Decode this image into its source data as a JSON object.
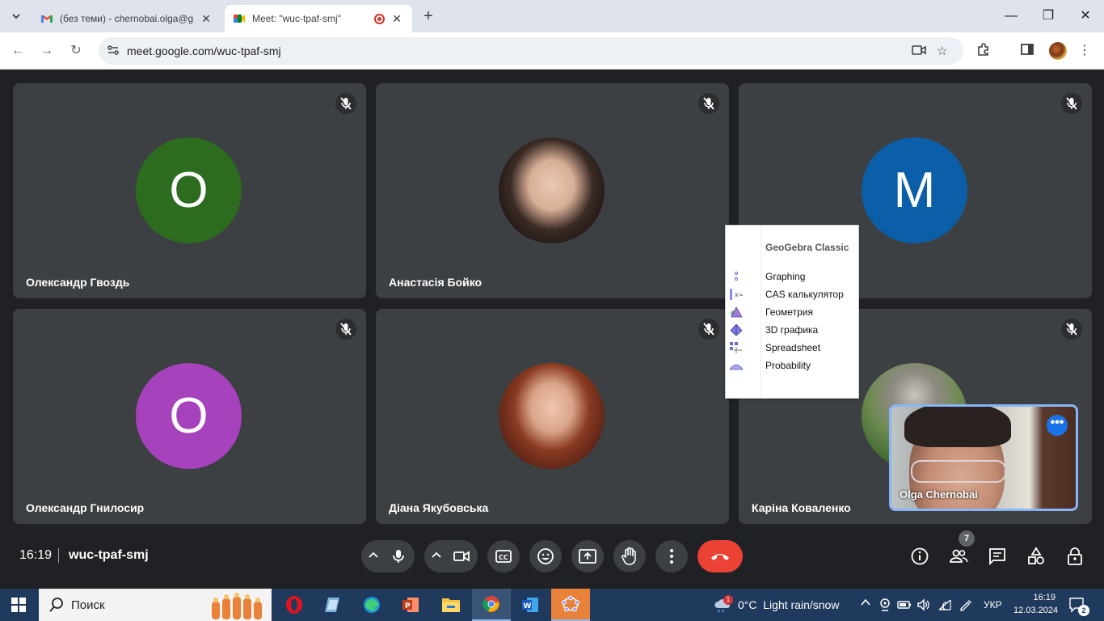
{
  "browser": {
    "tabs": [
      {
        "title": "(без теми) - chernobai.olga@gmail.com - Gmail",
        "favicon": "gmail-icon"
      },
      {
        "title": "Meet: \"wuc-tpaf-smj\"",
        "favicon": "meet-icon",
        "active": true
      }
    ],
    "url": "meet.google.com/wuc-tpaf-smj"
  },
  "meet": {
    "tiles": [
      {
        "name": "Олександр Гвоздь",
        "avatar_letter": "О",
        "avatar_color": "#2d6b1f"
      },
      {
        "name": "Анастасія Бойко",
        "avatar_photo": true
      },
      {
        "name": "",
        "avatar_letter": "M",
        "avatar_color": "#0b5fa8"
      },
      {
        "name": "Олександр Гнилосир",
        "avatar_letter": "О",
        "avatar_color": "#a742bd"
      },
      {
        "name": "Діана Якубовська",
        "avatar_photo": true
      },
      {
        "name": "Каріна Коваленко",
        "avatar_photo": true
      }
    ],
    "self_view": {
      "name": "Olga Chernobai"
    },
    "time": "16:19",
    "meeting_code": "wuc-tpaf-smj",
    "participants_count": "7"
  },
  "geogebra_menu": {
    "header": "GeoGebra Classic",
    "items": [
      {
        "label": "Graphing",
        "icon": "graphing-icon"
      },
      {
        "label": "CAS калькулятор",
        "icon": "cas-icon"
      },
      {
        "label": "Геометрия",
        "icon": "geometry-icon"
      },
      {
        "label": "3D графика",
        "icon": "3d-icon"
      },
      {
        "label": "Spreadsheet",
        "icon": "spreadsheet-icon"
      },
      {
        "label": "Probability",
        "icon": "probability-icon"
      }
    ]
  },
  "taskbar": {
    "search_label": "Поиск",
    "weather": "0°C  Light rain/snow",
    "weather_badge": "1",
    "lang": "УКР",
    "time": "16:19",
    "date": "12.03.2024",
    "notifications": "2"
  },
  "colors": {
    "tile_bg": "#3c4043",
    "control_bg": "#202124",
    "end_call": "#ea4335",
    "accent": "#1a73e8"
  }
}
